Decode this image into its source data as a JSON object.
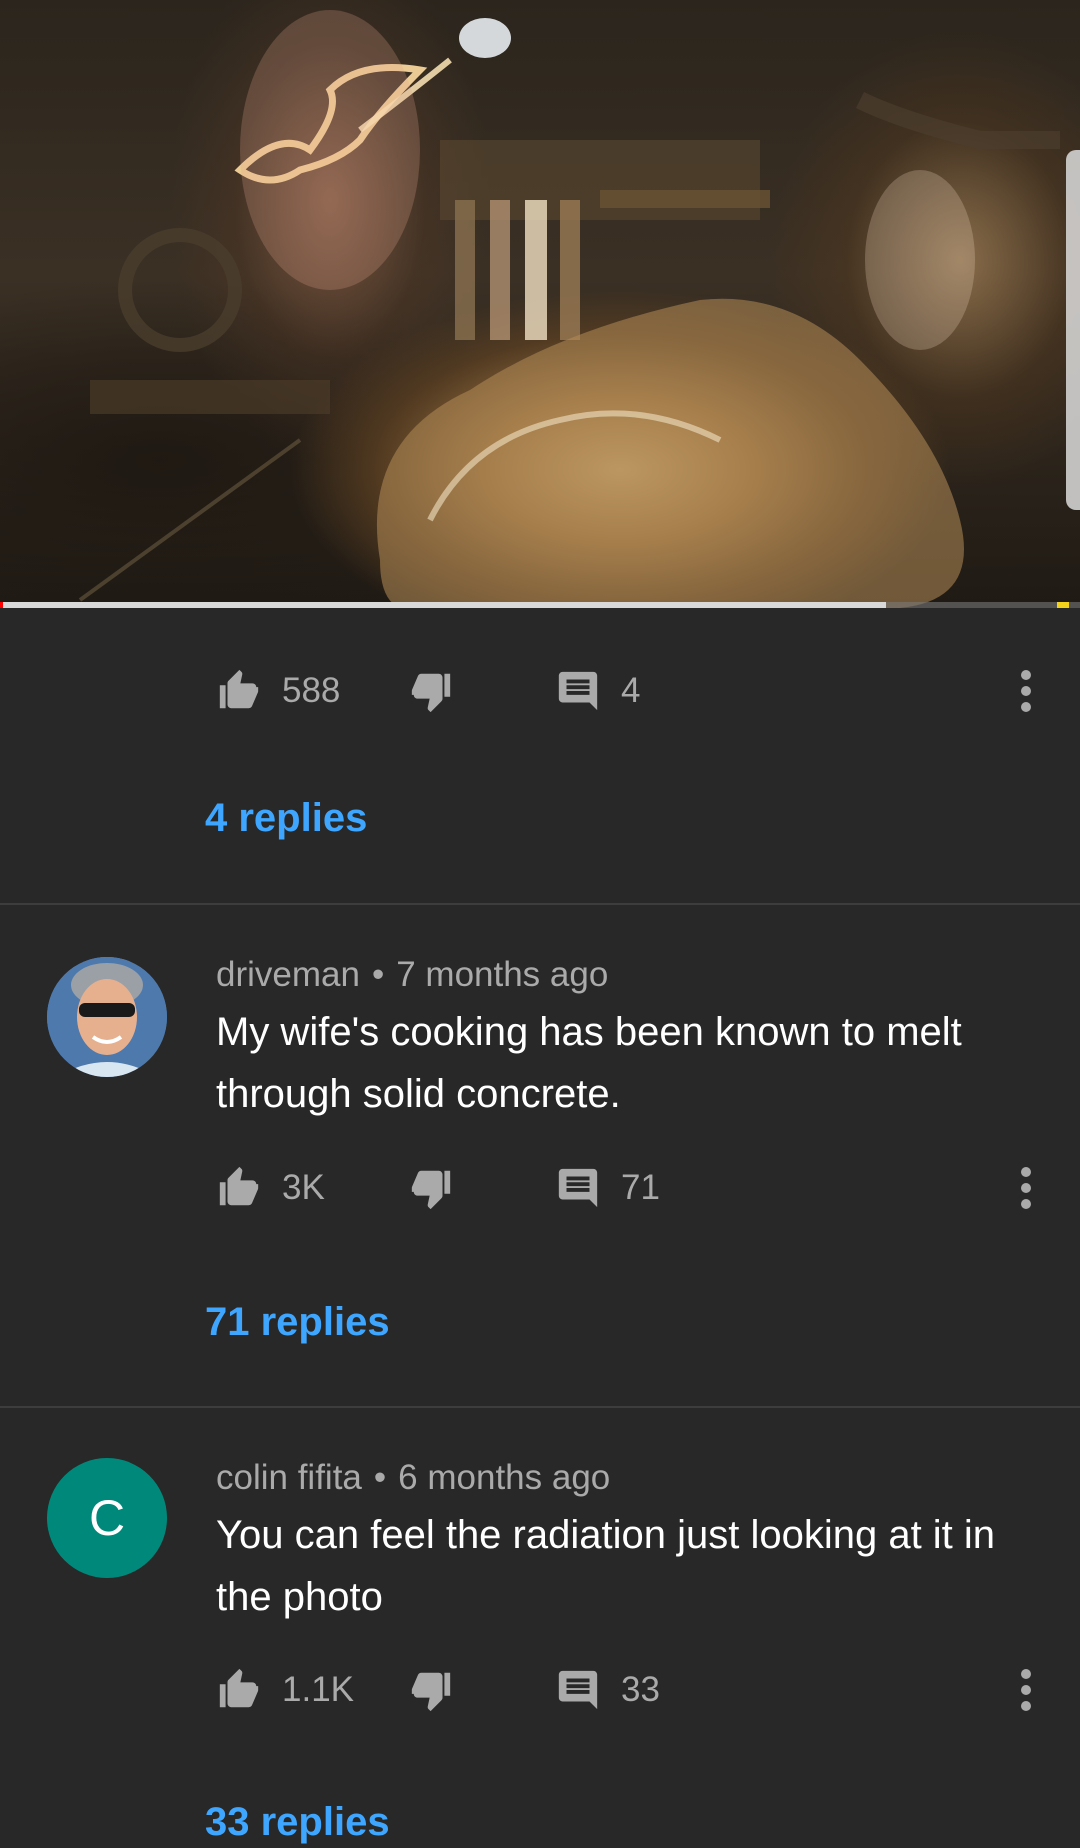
{
  "video": {
    "progress_played_fraction": 0.003,
    "progress_buffered_fraction": 0.82,
    "ad_marker_fraction": 0.99
  },
  "comments": [
    {
      "author": "",
      "time": "",
      "text": "",
      "likes": "588",
      "reply_count": "4",
      "replies_link": "4 replies"
    },
    {
      "author": "driveman",
      "time": "7 months ago",
      "text": "My wife's cooking has been known to melt through solid concrete.",
      "likes": "3K",
      "reply_count": "71",
      "replies_link": "71 replies",
      "avatar": "photo"
    },
    {
      "author": "colin fifita",
      "time": "6 months ago",
      "text": "You can feel the radiation just looking at it in the photo",
      "likes": "1.1K",
      "reply_count": "33",
      "replies_link": "33 replies",
      "avatar_letter": "C",
      "avatar_color": "#00897b"
    }
  ],
  "colors": {
    "background": "#282828",
    "link": "#3ea6ff",
    "secondary_text": "#aaaaaa"
  },
  "icons": {
    "like": "thumbs-up-icon",
    "dislike": "thumbs-down-icon",
    "reply": "comment-icon",
    "more": "more-vertical-icon"
  }
}
